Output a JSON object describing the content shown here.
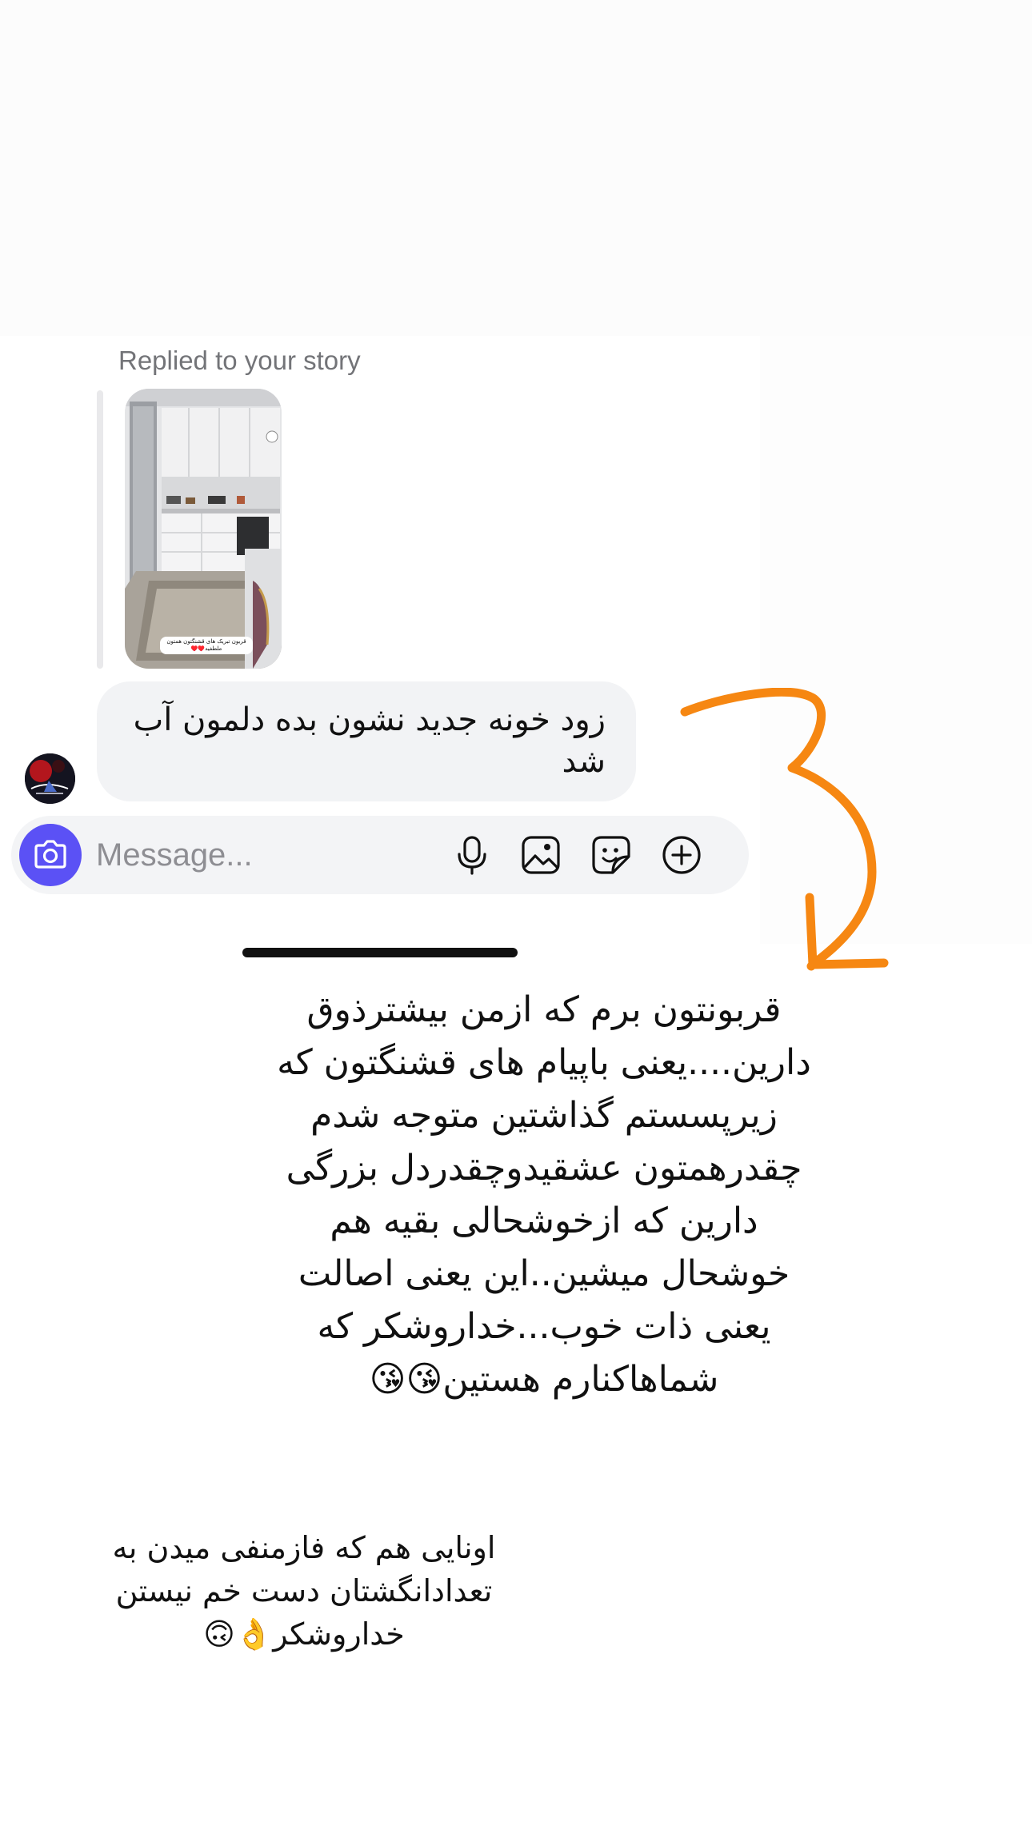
{
  "thread": {
    "replied_label": "Replied to your story",
    "story_caption": "قربون تبریک های قشنگتون همتون ملطفید♥️♥️",
    "message_text": "زود خونه جدید نشون بده دلمون آب شد"
  },
  "composer": {
    "placeholder": "Message...",
    "camera_icon": "camera-icon",
    "mic_icon": "microphone-icon",
    "gallery_icon": "image-icon",
    "sticker_icon": "sticker-icon",
    "more_icon": "plus-circle-icon",
    "accent_color": "#5B51F5"
  },
  "annotation": {
    "arrow_color": "#F68712",
    "arrow_icon": "curved-arrow-icon"
  },
  "overlay": {
    "main_text": "قربونتون برم که ازمن بیشترذوق دارین....یعنی باپیام های قشنگتون که زیرپسستم گذاشتین متوجه شدم چقدرهمتون عشقیدوچقدردل بزرگی دارین که ازخوشحالی بقیه هم خوشحال میشین..این یعنی اصالت یعنی ذات خوب...خداروشکر که شماهاکنارم هستین😘😘",
    "footer_text": "اونایی هم که فازمنفی میدن به تعدادانگشتان دست خم نیستن خداروشکر👌🙃"
  }
}
